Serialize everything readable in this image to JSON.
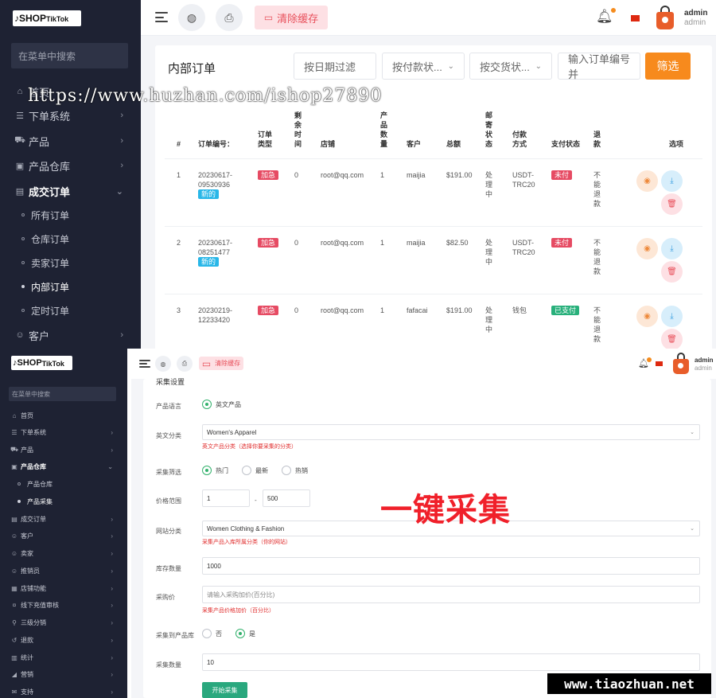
{
  "top": {
    "logo": {
      "main": "SHOP",
      "sub": "TikTok"
    },
    "sidebar": {
      "search_placeholder": "在菜单中搜索",
      "items": [
        {
          "label": "首页",
          "icon": "home-icon"
        },
        {
          "label": "下单系统",
          "icon": "list-icon"
        },
        {
          "label": "产品",
          "icon": "cart-icon"
        },
        {
          "label": "产品仓库",
          "icon": "box-icon"
        },
        {
          "label": "成交订单",
          "icon": "order-icon"
        },
        {
          "label": "所有订单"
        },
        {
          "label": "仓库订单"
        },
        {
          "label": "卖家订单"
        },
        {
          "label": "内部订单"
        },
        {
          "label": "定时订单"
        },
        {
          "label": "客户",
          "icon": "user-icon"
        }
      ]
    },
    "topbar": {
      "clear_cache": "清除缓存",
      "user_name": "admin",
      "user_role": "admin"
    },
    "card": {
      "title": "内部订单",
      "filter_date": "按日期过滤",
      "filter_payment": "按付款状...",
      "filter_delivery": "按交货状...",
      "search_placeholder": "输入订单编号并",
      "filter_button": "筛选"
    },
    "table": {
      "headers": [
        "#",
        "订单编号：",
        "订单类型",
        "剩余时间",
        "店铺",
        "产品数量",
        "客户",
        "总额",
        "邮寄状态",
        "付款方式",
        "支付状态",
        "退款",
        "选项"
      ],
      "rows": [
        {
          "idx": "1",
          "order_no": "20230617-09530936",
          "new_tag": "新的",
          "type": "加急",
          "remaining": "0",
          "shop": "root@qq.com",
          "qty": "1",
          "customer": "maijia",
          "total": "$191.00",
          "shipping": "处理中",
          "pay_method": "USDT-TRC20",
          "pay_status": "未付",
          "refund": "不能退款"
        },
        {
          "idx": "2",
          "order_no": "20230617-08251477",
          "new_tag": "新的",
          "type": "加急",
          "remaining": "0",
          "shop": "root@qq.com",
          "qty": "1",
          "customer": "maijia",
          "total": "$82.50",
          "shipping": "处理中",
          "pay_method": "USDT-TRC20",
          "pay_status": "未付",
          "refund": "不能退款"
        },
        {
          "idx": "3",
          "order_no": "20230219-12233420",
          "new_tag": "",
          "type": "加急",
          "remaining": "0",
          "shop": "root@qq.com",
          "qty": "1",
          "customer": "fafacai",
          "total": "$191.00",
          "shipping": "处理中",
          "pay_method": "钱包",
          "pay_status": "已支付",
          "refund": "不能退款"
        }
      ]
    },
    "watermark": "https://www.huzhan.com/ishop27890"
  },
  "bottom": {
    "logo": {
      "main": "SHOP",
      "sub": "TikTok"
    },
    "sidebar": {
      "search_placeholder": "在菜单中搜索",
      "items": [
        {
          "label": "首页"
        },
        {
          "label": "下单系统"
        },
        {
          "label": "产品"
        },
        {
          "label": "产品仓库"
        },
        {
          "label": "产品仓库"
        },
        {
          "label": "产品采集"
        },
        {
          "label": "成交订单"
        },
        {
          "label": "客户"
        },
        {
          "label": "卖家"
        },
        {
          "label": "推销员"
        },
        {
          "label": "店铺功能"
        },
        {
          "label": "线下充值审核"
        },
        {
          "label": "三级分销"
        },
        {
          "label": "退款"
        },
        {
          "label": "统计"
        },
        {
          "label": "营销"
        },
        {
          "label": "支持"
        }
      ]
    },
    "topbar": {
      "clear_cache": "清除缓存",
      "user_name": "admin",
      "user_role": "admin"
    },
    "form": {
      "section_title": "采集设置",
      "lang_label": "产品语言",
      "lang_option": "英文产品",
      "category_label": "英文分类",
      "category_value": "Women's Apparel",
      "category_hint": "英文产品分类（选择你要采集的分类）",
      "filter_label": "采集筛选",
      "filter_opts": [
        "热门",
        "最新",
        "热销"
      ],
      "price_label": "价格范围",
      "price_min": "1",
      "price_sep": "-",
      "price_max": "500",
      "site_cat_label": "网站分类",
      "site_cat_value": "Women Clothing & Fashion",
      "site_cat_hint": "采集产品入库所属分类（你的网站）",
      "stock_label": "库存数量",
      "stock_value": "1000",
      "markup_label": "采购价",
      "markup_placeholder": "请输入采购加价(百分比)",
      "markup_hint": "采集产品价格加价（百分比）",
      "to_store_label": "采集到产品库",
      "to_store_no": "否",
      "to_store_yes": "是",
      "count_label": "采集数量",
      "count_value": "10",
      "start_button": "开始采集"
    },
    "overlay_text": "一键采集",
    "watermark": "www.tiaozhuan.net"
  }
}
